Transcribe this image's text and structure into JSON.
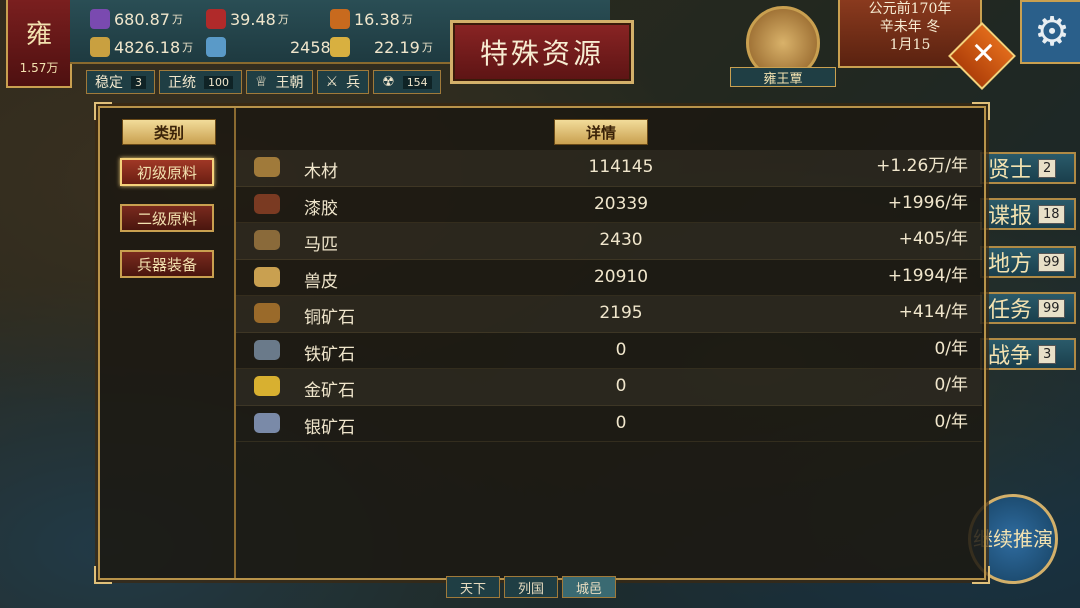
{
  "header": {
    "state_name": "雍",
    "state_value": "1.57万",
    "resources": [
      {
        "icon": "grape-icon",
        "color": "#7a4ab0",
        "value": "680.87",
        "unit": "万"
      },
      {
        "icon": "book-icon",
        "color": "#b02a2a",
        "value": "39.48",
        "unit": "万"
      },
      {
        "icon": "scroll-icon",
        "color": "#c86a1e",
        "value": "16.38",
        "unit": "万"
      },
      {
        "icon": "wheat-icon",
        "color": "#c9a040",
        "value": "4826.18",
        "unit": "万"
      },
      {
        "icon": "cloth-icon",
        "color": "#5a9ac8",
        "value": "2458",
        "unit": ""
      },
      {
        "icon": "person-icon",
        "color": "#d8b040",
        "value": "22.19",
        "unit": "万"
      }
    ],
    "stats": [
      {
        "label": "稳定",
        "value": "3"
      },
      {
        "label": "正统",
        "value": "100"
      },
      {
        "label": "王朝",
        "value": ""
      },
      {
        "label": "兵",
        "value": ""
      },
      {
        "label": "",
        "value": "154"
      }
    ]
  },
  "title": "特殊资源",
  "ruler": {
    "name": "雍王覃"
  },
  "date": {
    "line1": "公元前170年",
    "line2": "辛未年 冬",
    "line3": "1月15"
  },
  "panel": {
    "category_header": "类别",
    "details_header": "详情",
    "categories": [
      {
        "label": "初级原料",
        "active": true
      },
      {
        "label": "二级原料",
        "active": false
      },
      {
        "label": "兵器装备",
        "active": false
      }
    ],
    "rows": [
      {
        "icon": "wood-icon",
        "color": "#a07a3a",
        "name": "木材",
        "amount": "114145",
        "rate": "+1.26万/年"
      },
      {
        "icon": "lacquer-icon",
        "color": "#7a3a22",
        "name": "漆胶",
        "amount": "20339",
        "rate": "+1996/年"
      },
      {
        "icon": "horse-icon",
        "color": "#8a6a3a",
        "name": "马匹",
        "amount": "2430",
        "rate": "+405/年"
      },
      {
        "icon": "hide-icon",
        "color": "#c9a050",
        "name": "兽皮",
        "amount": "20910",
        "rate": "+1994/年"
      },
      {
        "icon": "copper-ore-icon",
        "color": "#9a6a2a",
        "name": "铜矿石",
        "amount": "2195",
        "rate": "+414/年"
      },
      {
        "icon": "iron-ore-icon",
        "color": "#6a7a8a",
        "name": "铁矿石",
        "amount": "0",
        "rate": "0/年"
      },
      {
        "icon": "gold-ore-icon",
        "color": "#d8b030",
        "name": "金矿石",
        "amount": "0",
        "rate": "0/年"
      },
      {
        "icon": "silver-ore-icon",
        "color": "#7a8aa8",
        "name": "银矿石",
        "amount": "0",
        "rate": "0/年"
      }
    ]
  },
  "sidebar": [
    {
      "label": "贤士",
      "count": "2"
    },
    {
      "label": "谍报",
      "count": "18"
    },
    {
      "label": "地方",
      "count": "99"
    },
    {
      "label": "任务",
      "count": "99"
    },
    {
      "label": "战争",
      "count": "3"
    }
  ],
  "continue_button": "继续推演",
  "bottom_tabs": [
    {
      "label": "天下"
    },
    {
      "label": "列国"
    },
    {
      "label": "城邑"
    }
  ]
}
